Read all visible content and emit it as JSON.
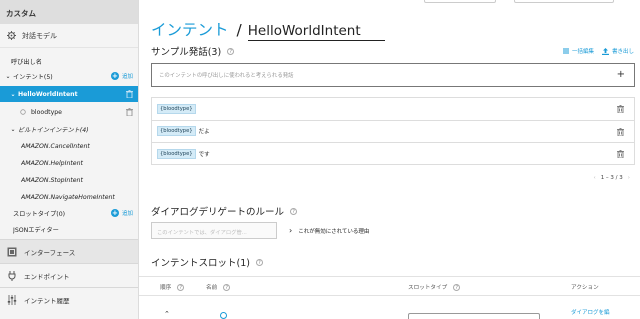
{
  "sidebar": {
    "custom_label": "カスタム",
    "model_label": "対話モデル",
    "invocation_name": "呼び出し名",
    "intents_label": "インテント(5)",
    "add_label": "追加",
    "hello_intent": "HelloWorldIntent",
    "bloodtype_slot": "bloodtype",
    "builtin_label": "ビルトインインテント(4)",
    "builtins": [
      "AMAZON.CancelIntent",
      "AMAZON.HelpIntent",
      "AMAZON.StopIntent",
      "AMAZON.NavigateHomeIntent"
    ],
    "slot_types_label": "スロットタイプ(0)",
    "json_editor": "JSONエディター",
    "interfaces": "インターフェース",
    "endpoint": "エンドポイント",
    "intent_history": "インテント履歴"
  },
  "main": {
    "title_intent": "インテント",
    "title_slash": "/",
    "intent_name": "HelloWorldIntent",
    "sample_heading": "サンプル発話(3)",
    "bulk_edit": "一括編集",
    "export": "書き出し",
    "utterance_placeholder": "このインテントの呼び出しに使われると考えられる発話",
    "utterances": [
      {
        "slot": "{bloodtype}",
        "text": ""
      },
      {
        "slot": "{bloodtype}",
        "text": "だよ"
      },
      {
        "slot": "{bloodtype}",
        "text": "です"
      }
    ],
    "pager_range": "1 – 3 / 3",
    "dialog_heading": "ダイアログデリゲートのルール",
    "dialog_select": "このインテントでは、ダイアログ管...",
    "dialog_reason": "これが無効にされている理由",
    "slots_heading": "インテントスロット(1)",
    "columns": {
      "order": "順序",
      "name": "名前",
      "slot_type": "スロットタイプ",
      "action": "アクション"
    },
    "row_action": "ダイアログを編"
  },
  "colors": {
    "accent": "#1a9bd7",
    "sidebar_bg": "#f4f4f4",
    "slot_chip": "#d4ebf7"
  }
}
